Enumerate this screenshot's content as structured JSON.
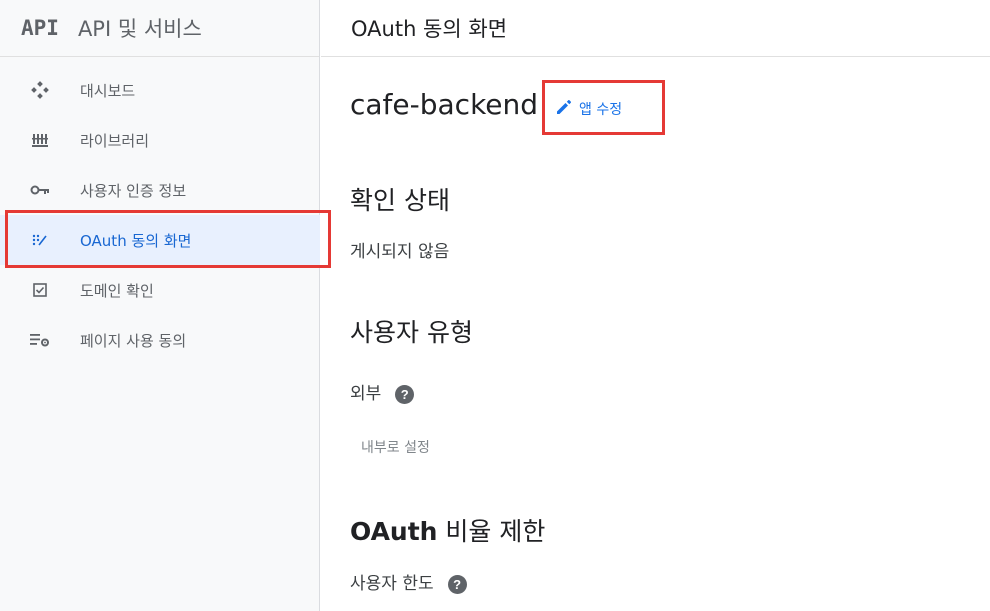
{
  "sidebar": {
    "logo": "API",
    "title": "API 및 서비스",
    "items": [
      {
        "label": "대시보드",
        "icon": "dashboard-icon"
      },
      {
        "label": "라이브러리",
        "icon": "library-icon"
      },
      {
        "label": "사용자 인증 정보",
        "icon": "key-icon"
      },
      {
        "label": "OAuth 동의 화면",
        "icon": "oauth-consent-icon",
        "active": true
      },
      {
        "label": "도메인 확인",
        "icon": "domain-check-icon"
      },
      {
        "label": "페이지 사용 동의",
        "icon": "page-consent-icon"
      }
    ]
  },
  "header": {
    "title": "OAuth 동의 화면"
  },
  "app": {
    "name": "cafe-backend",
    "edit_label": "앱 수정"
  },
  "verification": {
    "title": "확인 상태",
    "status": "게시되지 않음"
  },
  "user_type": {
    "title": "사용자 유형",
    "value": "외부",
    "help": "?",
    "make_internal": "내부로 설정"
  },
  "rate_limit": {
    "title_bold": "OAuth",
    "title_rest": " 비율 제한",
    "user_limit": "사용자 한도",
    "help": "?"
  },
  "colors": {
    "accent": "#1a73e8",
    "active_bg": "#e8f0fe",
    "highlight": "#e53935"
  }
}
